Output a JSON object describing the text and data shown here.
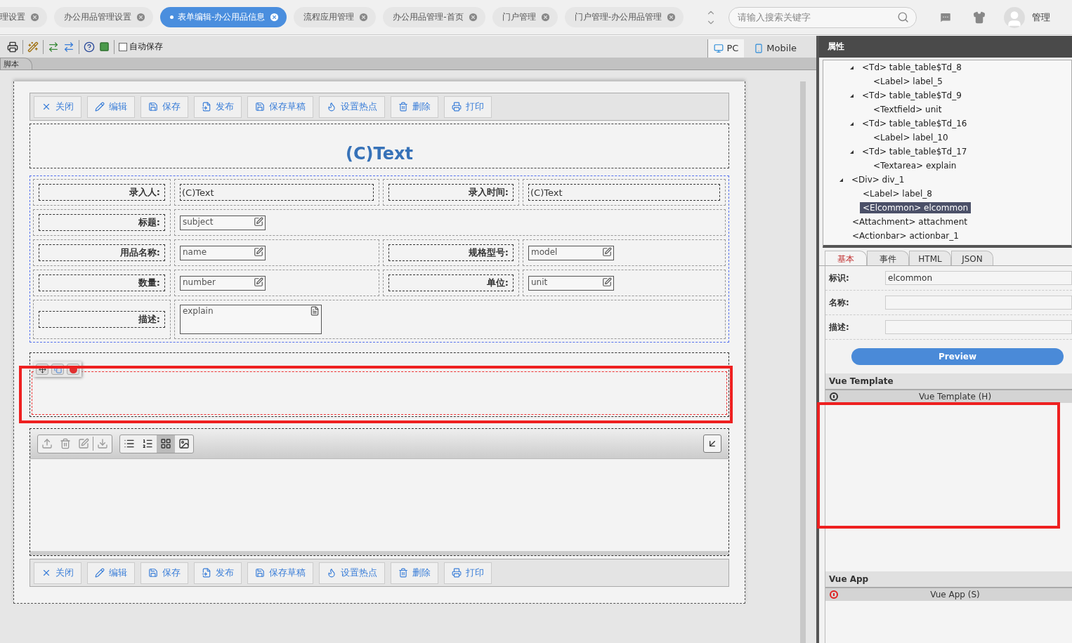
{
  "tabs": [
    {
      "label": "理设置",
      "selected": false
    },
    {
      "label": "办公用品管理设置",
      "selected": false
    },
    {
      "label": "表单编辑-办公用品信息",
      "selected": true
    },
    {
      "label": "流程应用管理",
      "selected": false
    },
    {
      "label": "办公用品管理-首页",
      "selected": false
    },
    {
      "label": "门户管理",
      "selected": false
    },
    {
      "label": "门户管理-办公用品管理",
      "selected": false
    }
  ],
  "search": {
    "placeholder": "请输入搜索关键字"
  },
  "user": {
    "name": "管理"
  },
  "autosave": {
    "label": "自动保存",
    "checked": false
  },
  "device_tabs": [
    {
      "label": "PC",
      "kind": "pc",
      "selected": true
    },
    {
      "label": "Mobile",
      "kind": "mobile",
      "selected": false
    }
  ],
  "script_tab": {
    "label": "脚本"
  },
  "form": {
    "actionbar": [
      {
        "kind": "close",
        "label": "关闭"
      },
      {
        "kind": "edit",
        "label": "编辑"
      },
      {
        "kind": "save",
        "label": "保存"
      },
      {
        "kind": "publish",
        "label": "发布"
      },
      {
        "kind": "draft",
        "label": "保存草稿"
      },
      {
        "kind": "hotspot",
        "label": "设置热点"
      },
      {
        "kind": "delete",
        "label": "删除"
      },
      {
        "kind": "print",
        "label": "打印"
      }
    ],
    "title": "(C)Text",
    "rows": [
      [
        {
          "kind": "label",
          "text": "录入人:"
        },
        {
          "kind": "text",
          "text": "(C)Text"
        },
        {
          "kind": "label",
          "text": "录入时间:"
        },
        {
          "kind": "text",
          "text": "(C)Text"
        }
      ],
      [
        {
          "kind": "label",
          "text": "标题:"
        },
        {
          "kind": "field",
          "text": "subject"
        }
      ],
      [
        {
          "kind": "label",
          "text": "用品名称:"
        },
        {
          "kind": "field",
          "text": "name"
        },
        {
          "kind": "label",
          "text": "规格型号:"
        },
        {
          "kind": "field",
          "text": "model"
        }
      ],
      [
        {
          "kind": "label",
          "text": "数量:"
        },
        {
          "kind": "field",
          "text": "number"
        },
        {
          "kind": "label",
          "text": "单位:"
        },
        {
          "kind": "field",
          "text": "unit"
        }
      ],
      [
        {
          "kind": "label",
          "text": "描述:"
        },
        {
          "kind": "textarea",
          "text": "explain"
        }
      ]
    ],
    "attachment_views": [
      {
        "kind": "bullets",
        "selected": false
      },
      {
        "kind": "numbered",
        "selected": false
      },
      {
        "kind": "grid",
        "selected": true
      },
      {
        "kind": "image",
        "selected": false
      }
    ],
    "bottom_actionbar": [
      {
        "kind": "close",
        "label": "关闭"
      },
      {
        "kind": "edit",
        "label": "编辑"
      },
      {
        "kind": "save",
        "label": "保存"
      },
      {
        "kind": "publish",
        "label": "发布"
      },
      {
        "kind": "draft",
        "label": "保存草稿"
      },
      {
        "kind": "hotspot",
        "label": "设置热点"
      },
      {
        "kind": "delete",
        "label": "删除"
      },
      {
        "kind": "print",
        "label": "打印"
      }
    ]
  },
  "panel": {
    "title": "属性",
    "tree_partial": [
      {
        "label": "<Td> table_table$Td_8",
        "expanded": true,
        "children": [
          {
            "label": "<Label> label_5",
            "selected": false
          }
        ]
      },
      {
        "label": "<Td> table_table$Td_9",
        "expanded": true,
        "children": [
          {
            "label": "<Textfield> unit",
            "selected": false
          }
        ]
      },
      {
        "label": "<Td> table_table$Td_16",
        "expanded": true,
        "children": [
          {
            "label": "<Label> label_10",
            "selected": false
          }
        ]
      },
      {
        "label": "<Td> table_table$Td_17",
        "expanded": true,
        "children": [
          {
            "label": "<Textarea> explain",
            "selected": false
          }
        ]
      }
    ],
    "tree": [
      {
        "label": "<Div> div_1",
        "expanded": true,
        "children": [
          {
            "label": "<Label> label_8",
            "selected": false
          },
          {
            "label": "<Elcommon> elcommon",
            "selected": true
          }
        ]
      },
      {
        "label": "<Attachment> attachment",
        "selected": false
      },
      {
        "label": "<Actionbar> actionbar_1",
        "selected": false
      }
    ],
    "tabs": [
      {
        "label": "基本",
        "selected": true
      },
      {
        "label": "事件",
        "selected": false
      },
      {
        "label": "HTML",
        "selected": false
      },
      {
        "label": "JSON",
        "selected": false
      }
    ],
    "props": [
      {
        "label": "标识:",
        "value": "elcommon"
      },
      {
        "label": "名称:"
      },
      {
        "label": "描述:"
      }
    ],
    "preview": "Preview",
    "code_sections": [
      {
        "title": "Vue Template",
        "editor": "Vue Template (H)",
        "color": "#333333"
      },
      {
        "title": "Vue App",
        "editor": "Vue App (S)",
        "color": "#e02020"
      }
    ]
  }
}
